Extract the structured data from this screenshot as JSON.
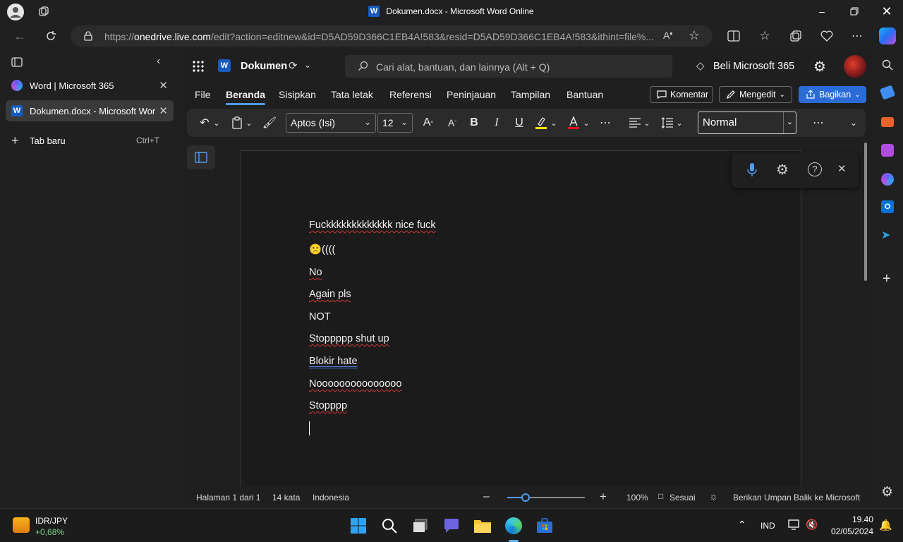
{
  "window": {
    "title": "Dokumen.docx - Microsoft Word Online"
  },
  "browser": {
    "url_prefix": "https://",
    "url_host": "onedrive.live.com",
    "url_rest": "/edit?action=editnew&id=D5AD59D366C1EB4A!583&resid=D5AD59D366C1EB4A!583&ithint=file%..."
  },
  "tabs": [
    {
      "label": "Word | Microsoft 365",
      "active": false
    },
    {
      "label": "Dokumen.docx - Microsoft Word",
      "active": true
    }
  ],
  "new_tab": {
    "label": "Tab baru",
    "shortcut": "Ctrl+T"
  },
  "word": {
    "doc_name": "Dokumen",
    "search_placeholder": "Cari alat, bantuan, dan lainnya (Alt + Q)",
    "buy_label": "Beli Microsoft 365",
    "ribbon_tabs": [
      "File",
      "Beranda",
      "Sisipkan",
      "Tata letak",
      "Referensi",
      "Peninjauan",
      "Tampilan",
      "Bantuan"
    ],
    "active_tab": "Beranda",
    "comment_label": "Komentar",
    "editing_label": "Mengedit",
    "share_label": "Bagikan",
    "font_name": "Aptos (Isi)",
    "font_size": "12",
    "style": "Normal"
  },
  "document": {
    "paragraphs": [
      "Fuckkkkkkkkkkkkk nice fuck",
      "🙁((((",
      "No",
      "Again pls",
      "NOT",
      "Stoppppp shut up",
      "Blokir hate",
      "Nooooooooooooooo",
      "Stopppp"
    ]
  },
  "status": {
    "page": "Halaman 1 dari 1",
    "words": "14 kata",
    "language": "Indonesia",
    "zoom": "100%",
    "fit": "Sesuai",
    "feedback": "Berikan Umpan Balik ke Microsoft"
  },
  "taskbar": {
    "ticker_name": "IDR/JPY",
    "ticker_change": "+0,68%",
    "lang": "IND",
    "time": "19.40",
    "date": "02/05/2024"
  },
  "colors": {
    "accent": "#2b6bd6",
    "word_blue": "#185abd",
    "spell_red": "#d13438"
  }
}
